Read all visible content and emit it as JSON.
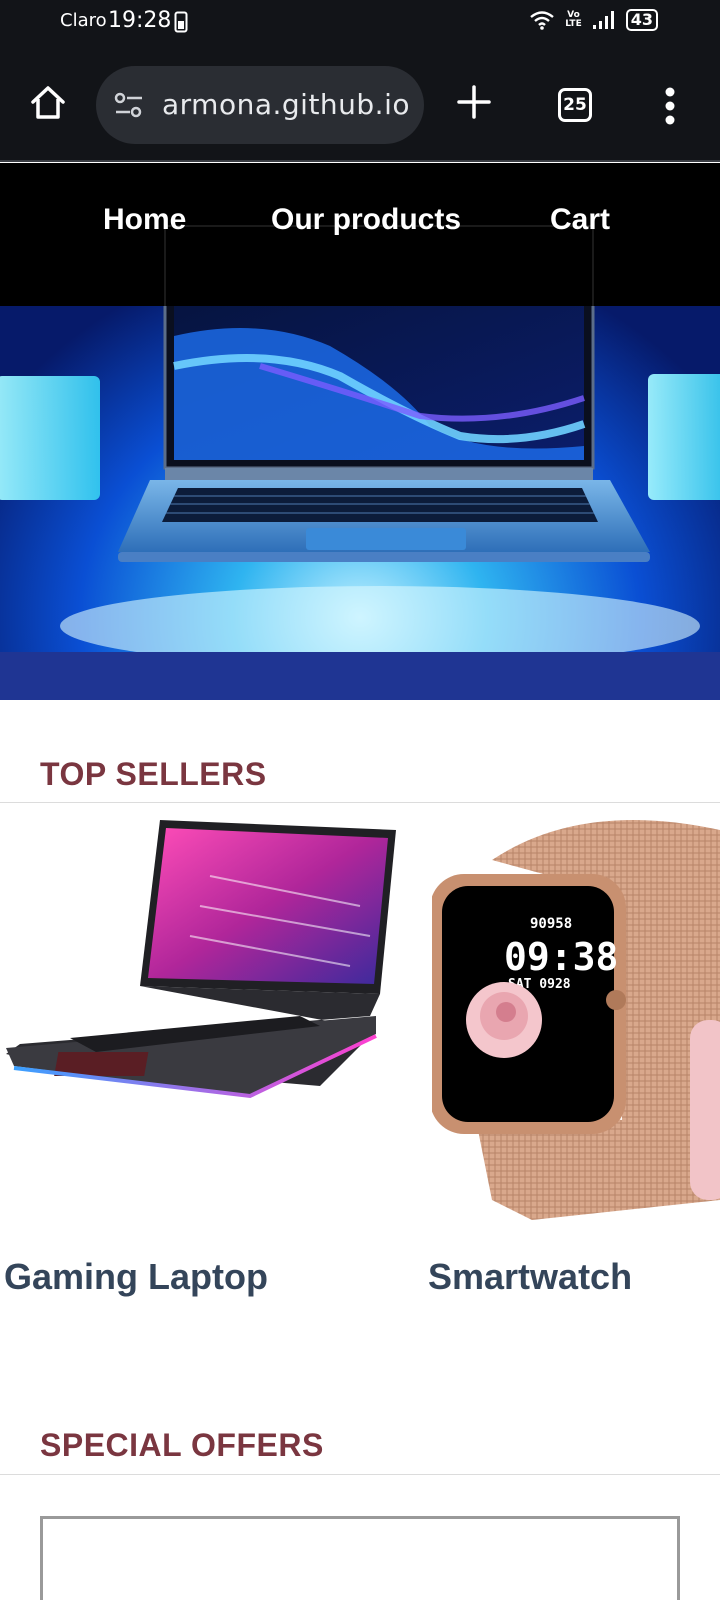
{
  "status_bar": {
    "carrier": "Claro",
    "time": "19:28",
    "volte_top": "Vo",
    "volte_bottom": "LTE",
    "battery": "43"
  },
  "browser": {
    "url": "armona.github.io",
    "tab_count": "25",
    "icons": [
      "home-icon",
      "site-settings-icon",
      "new-tab-plus-icon",
      "tab-switcher-icon",
      "overflow-menu-icon"
    ]
  },
  "site_nav": {
    "links": [
      "Home",
      "Our products",
      "Cart"
    ]
  },
  "sections": {
    "top_sellers": {
      "title": "TOP SELLERS",
      "products": [
        {
          "name": "Gaming Laptop"
        },
        {
          "name": "Smartwatch"
        }
      ]
    },
    "special_offers": {
      "title": "SPECIAL OFFERS"
    }
  },
  "colors": {
    "browser_chrome": "#121418",
    "nav_background": "#000000",
    "hero_strip": "#1f3593",
    "section_title": "#7a3640",
    "product_name": "#34455a"
  }
}
